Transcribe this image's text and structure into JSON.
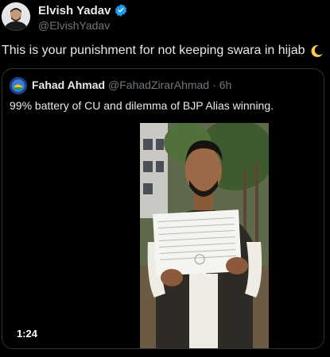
{
  "author": {
    "name": "Elvish Yadav",
    "handle": "@ElvishYadav",
    "verified_color": "#1d9bf0"
  },
  "tweet": {
    "text": "This is your punishment for not keeping swara in hijab",
    "emoji": "crescent-moon-icon"
  },
  "quote": {
    "name": "Fahad Ahmad",
    "handle": "@FahadZirarAhmad",
    "separator": "·",
    "time": "6h",
    "text": "99% battery of CU and dilemma of BJP Alias winning.",
    "video": {
      "duration": "1:24"
    }
  },
  "colors": {
    "background": "#000000",
    "text_primary": "#e7e9ea",
    "text_secondary": "#71767b",
    "border": "#2f3336"
  }
}
